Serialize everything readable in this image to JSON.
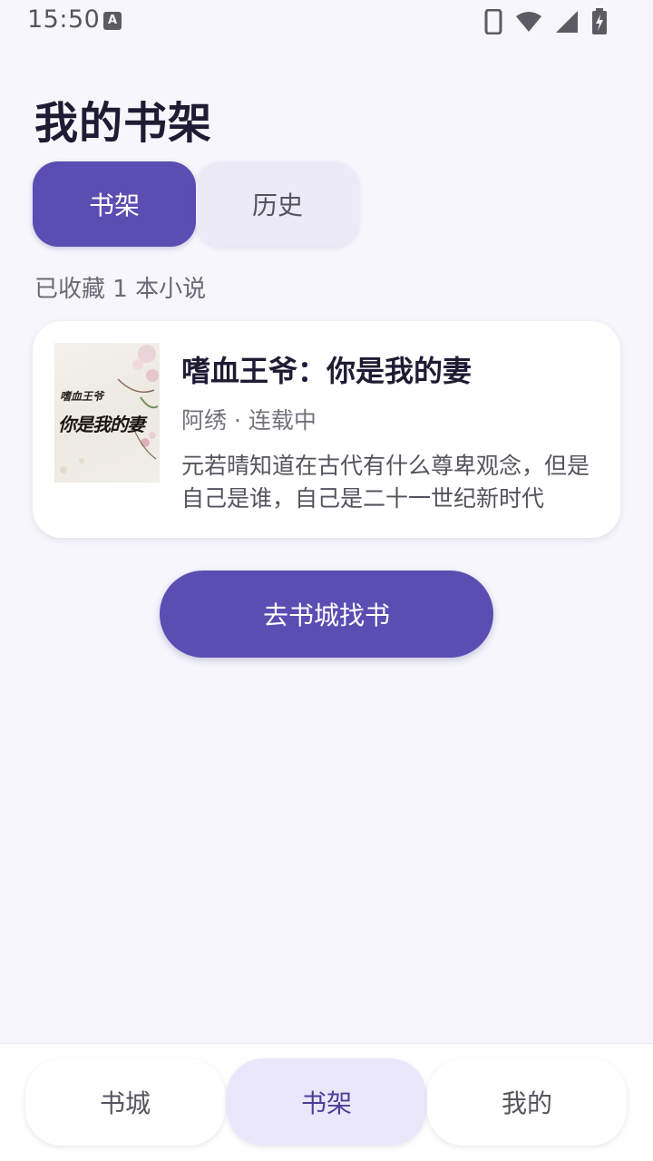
{
  "status_bar": {
    "time": "15:50",
    "notification_icon": "A"
  },
  "page": {
    "title": "我的书架"
  },
  "tabs": [
    {
      "label": "书架",
      "active": true
    },
    {
      "label": "历史",
      "active": false
    }
  ],
  "shelf": {
    "count_text": "已收藏 1 本小说",
    "books": [
      {
        "title": "嗜血王爷：你是我的妻",
        "meta": "阿绣 · 连载中",
        "description": "元若晴知道在古代有什么尊卑观念，但是自己是谁，自己是二十一世纪新时代",
        "cover_text_small": "嗜血王爷",
        "cover_text_large": "你是我的妻"
      }
    ]
  },
  "actions": {
    "go_store_label": "去书城找书"
  },
  "bottom_nav": [
    {
      "label": "书城",
      "active": false
    },
    {
      "label": "书架",
      "active": true
    },
    {
      "label": "我的",
      "active": false
    }
  ],
  "colors": {
    "accent": "#5b4db2",
    "background": "#f6f6fc",
    "nav_active_bg": "#ebe7fb"
  }
}
